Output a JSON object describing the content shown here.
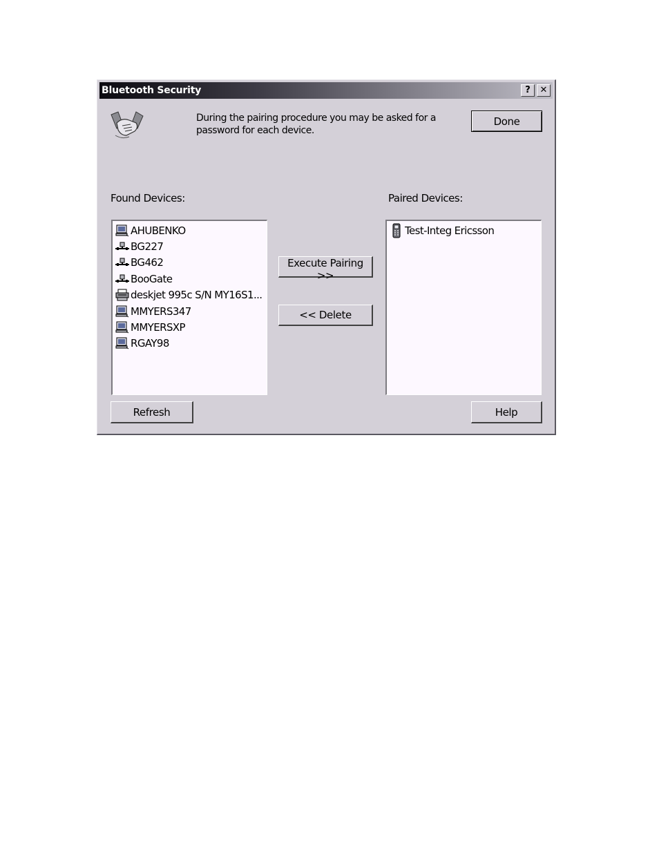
{
  "window": {
    "title": "Bluetooth Security",
    "help_glyph": "?",
    "close_glyph": "✕"
  },
  "header": {
    "icon": "handshake-icon",
    "description": "During the pairing procedure you may be asked for a password for each device.",
    "done_label": "Done"
  },
  "found": {
    "label": "Found Devices:",
    "items": [
      {
        "name": "AHUBENKO",
        "icon": "computer-icon"
      },
      {
        "name": "BG227",
        "icon": "network-icon"
      },
      {
        "name": "BG462",
        "icon": "network-icon"
      },
      {
        "name": "BooGate",
        "icon": "network-icon"
      },
      {
        "name": "deskjet 995c S/N MY16S1...",
        "icon": "printer-icon"
      },
      {
        "name": "MMYERS347",
        "icon": "computer-icon"
      },
      {
        "name": "MMYERSXP",
        "icon": "computer-icon"
      },
      {
        "name": "RGAY98",
        "icon": "computer-icon"
      }
    ]
  },
  "paired": {
    "label": "Paired Devices:",
    "items": [
      {
        "name": "Test-Integ Ericsson",
        "icon": "phone-icon"
      }
    ]
  },
  "actions": {
    "execute_label": "Execute Pairing >>",
    "delete_label": "<< Delete",
    "refresh_label": "Refresh",
    "help_label": "Help"
  }
}
